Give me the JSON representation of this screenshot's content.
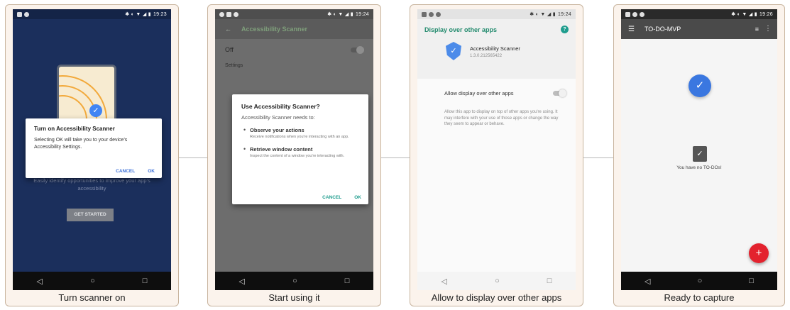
{
  "panels": [
    {
      "caption": "Turn scanner on",
      "status_time": "19:23",
      "dialog": {
        "title": "Turn on Accessibility Scanner",
        "body": "Selecting OK will take you to your device's Accessibility Settings.",
        "cancel": "CANCEL",
        "ok": "OK"
      },
      "tagline": "Easily identify opportunities to improve your app's accessibility",
      "get_started": "GET STARTED"
    },
    {
      "caption": "Start using it",
      "status_time": "19:24",
      "appbar_title": "Accessibility Scanner",
      "toggle_label": "Off",
      "settings_label": "Settings",
      "dialog": {
        "title": "Use Accessibility Scanner?",
        "needs": "Accessibility Scanner needs to:",
        "permissions": [
          {
            "title": "Observe your actions",
            "desc": "Receive notifications when you're interacting with an app."
          },
          {
            "title": "Retrieve window content",
            "desc": "Inspect the content of a window you're interacting with."
          }
        ],
        "cancel": "CANCEL",
        "ok": "OK"
      }
    },
    {
      "caption": "Allow to display over other apps",
      "status_time": "19:24",
      "title": "Display over other apps",
      "app_name": "Accessibility Scanner",
      "app_version": "1.3.0.212565422",
      "allow_label": "Allow display over other apps",
      "description": "Allow this app to display on top of other apps you're using. It may interfere with your use of those apps or change the way they seem to appear or behave."
    },
    {
      "caption": "Ready to capture",
      "status_time": "19:26",
      "appbar_title": "TO-DO-MVP",
      "empty_text": "You have no TO-DOs!",
      "fab_symbol": "+"
    }
  ],
  "nav_symbols": {
    "back": "◁",
    "home": "○",
    "recents": "□"
  },
  "icons": [
    "menu-icon",
    "filter-icon",
    "more-icon",
    "shield-check-icon",
    "clipboard-icon",
    "check-icon",
    "help-icon"
  ]
}
